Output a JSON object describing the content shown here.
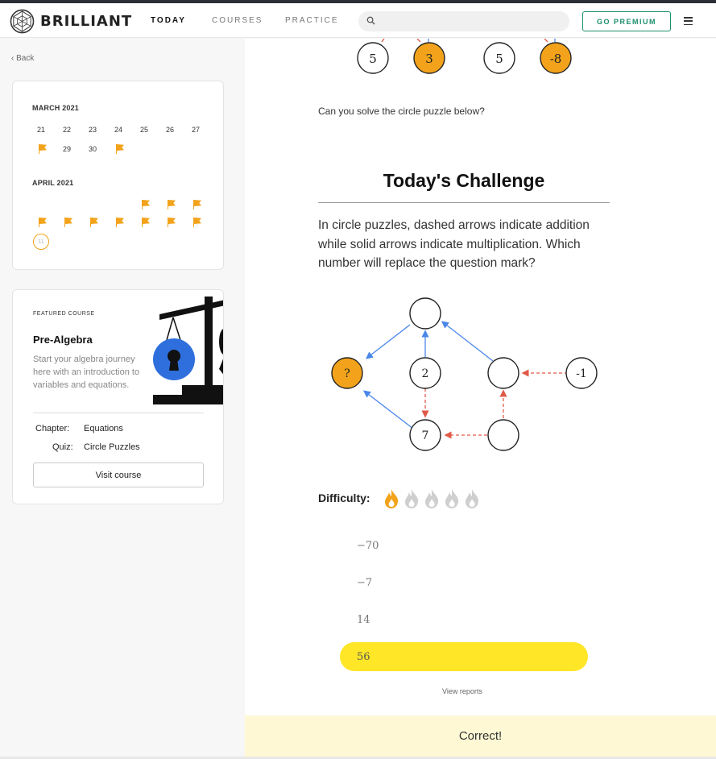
{
  "header": {
    "brand": "BRILLIANT",
    "nav": [
      "TODAY",
      "COURSES",
      "PRACTICE"
    ],
    "active_nav": "TODAY",
    "search": {
      "placeholder": ""
    },
    "premium_label": "GO PREMIUM",
    "icons": [
      "brilliant-logo-icon",
      "search-icon",
      "hamburger-menu-icon"
    ]
  },
  "sidebar": {
    "back_label": "Back",
    "calendar": {
      "march": {
        "label": "MARCH 2021",
        "row1": [
          "21",
          "22",
          "23",
          "24",
          "25",
          "26",
          "27"
        ],
        "row2": [
          "flag",
          "29",
          "30",
          "flag"
        ]
      },
      "april": {
        "label": "APRIL 2021",
        "row1": [
          "",
          "",
          "",
          "",
          "flag",
          "flag",
          "flag"
        ],
        "row2": [
          "flag",
          "flag",
          "flag",
          "flag",
          "flag",
          "flag",
          "flag"
        ],
        "today": "11"
      },
      "flag_color": "#f2a31b"
    },
    "featured": {
      "label": "FEATURED COURSE",
      "title": "Pre-Algebra",
      "description": "Start your algebra journey here with an introduction to variables and equations.",
      "chapter_label": "Chapter:",
      "chapter_value": "Equations",
      "quiz_label": "Quiz:",
      "quiz_value": "Circle Puzzles",
      "button_label": "Visit course"
    }
  },
  "main": {
    "example_circles": [
      "5",
      "3",
      "5",
      "-8"
    ],
    "prompt": "Can you solve the circle puzzle below?",
    "challenge_title": "Today's Challenge",
    "question": "In circle puzzles, dashed arrows indicate addition while solid arrows indicate multiplication. Which number will replace the question mark?",
    "puzzle_nodes": {
      "question": "?",
      "middle": "2",
      "bottom": "7",
      "right": "-1"
    },
    "difficulty_label": "Difficulty:",
    "difficulty_level": 1,
    "difficulty_max": 5,
    "choices": [
      "−70",
      "−7",
      "14",
      "56"
    ],
    "selected_choice": "56",
    "view_reports": "View reports",
    "result": "Correct!",
    "colors": {
      "accent_orange": "#f2a31b",
      "selected_yellow": "#ffe627",
      "solid_arrow": "#4a86e8",
      "dashed_arrow": "#e05a48",
      "premium_green": "#1d8f6d",
      "footer_bg": "#fef8d4"
    }
  }
}
